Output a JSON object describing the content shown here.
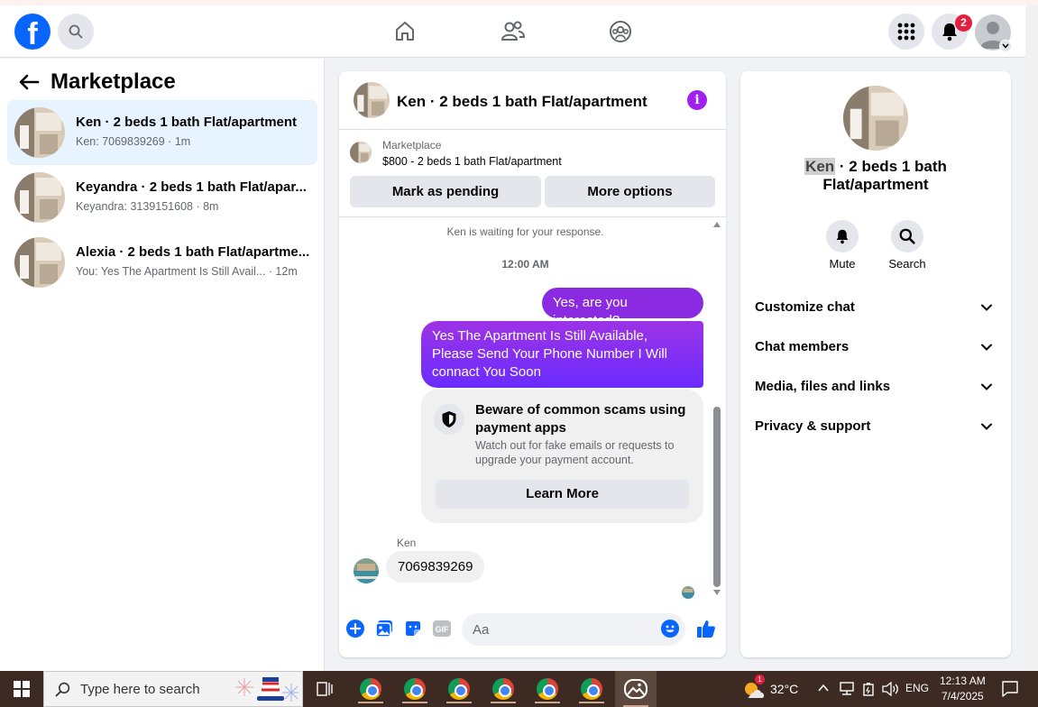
{
  "topbar": {
    "logo": "f",
    "notification_count": "2",
    "icons": [
      "facebook-logo",
      "search-icon",
      "home-icon",
      "friends-icon",
      "groups-icon",
      "menu-grid-icon",
      "bell-icon",
      "profile-avatar",
      "chevron-down-icon"
    ]
  },
  "left_panel": {
    "title": "Marketplace",
    "conversations": [
      {
        "title": "Ken · 2 beds 1 bath Flat/apartment",
        "subtitle": "Ken: 7069839269 · 1m",
        "active": true
      },
      {
        "title": "Keyandra · 2 beds 1 bath Flat/apar...",
        "subtitle": "Keyandra: 3139151608 · 8m",
        "active": false
      },
      {
        "title": "Alexia · 2 beds 1 bath Flat/apartme...",
        "subtitle": "You: Yes The Apartment Is Still Avail... · 12m",
        "active": false
      }
    ]
  },
  "chat": {
    "title": "Ken · 2 beds 1 bath Flat/apartment",
    "listing_label": "Marketplace",
    "listing_price": "$800 - 2 beds 1 bath Flat/apartment",
    "mark_pending": "Mark as pending",
    "more_options": "More options",
    "waiting_text": "Ken is waiting for your response.",
    "time_sep": "12:00 AM",
    "out_msg_1": "Yes, are you interested?",
    "out_msg_2": "Yes The Apartment Is Still Available, Please Send Your Phone Number I Will connact You Soon",
    "scam_title": "Beware of common scams using payment apps",
    "scam_body": "Watch out for fake emails or requests to upgrade your payment account.",
    "learn_more": "Learn More",
    "sender": "Ken",
    "in_msg": "7069839269",
    "composer_placeholder": "Aa",
    "accent_color": "#8a2be2"
  },
  "info_panel": {
    "name_highlight": "Ken",
    "name_rest": " · 2 beds 1 bath Flat/apartment",
    "mute": "Mute",
    "search": "Search",
    "rows": [
      "Customize chat",
      "Chat members",
      "Media, files and links",
      "Privacy & support"
    ]
  },
  "taskbar": {
    "search_placeholder": "Type here to search",
    "temperature": "32°C",
    "language": "ENG",
    "time": "12:13 AM",
    "date": "7/4/2025",
    "weather_badge": "1"
  }
}
